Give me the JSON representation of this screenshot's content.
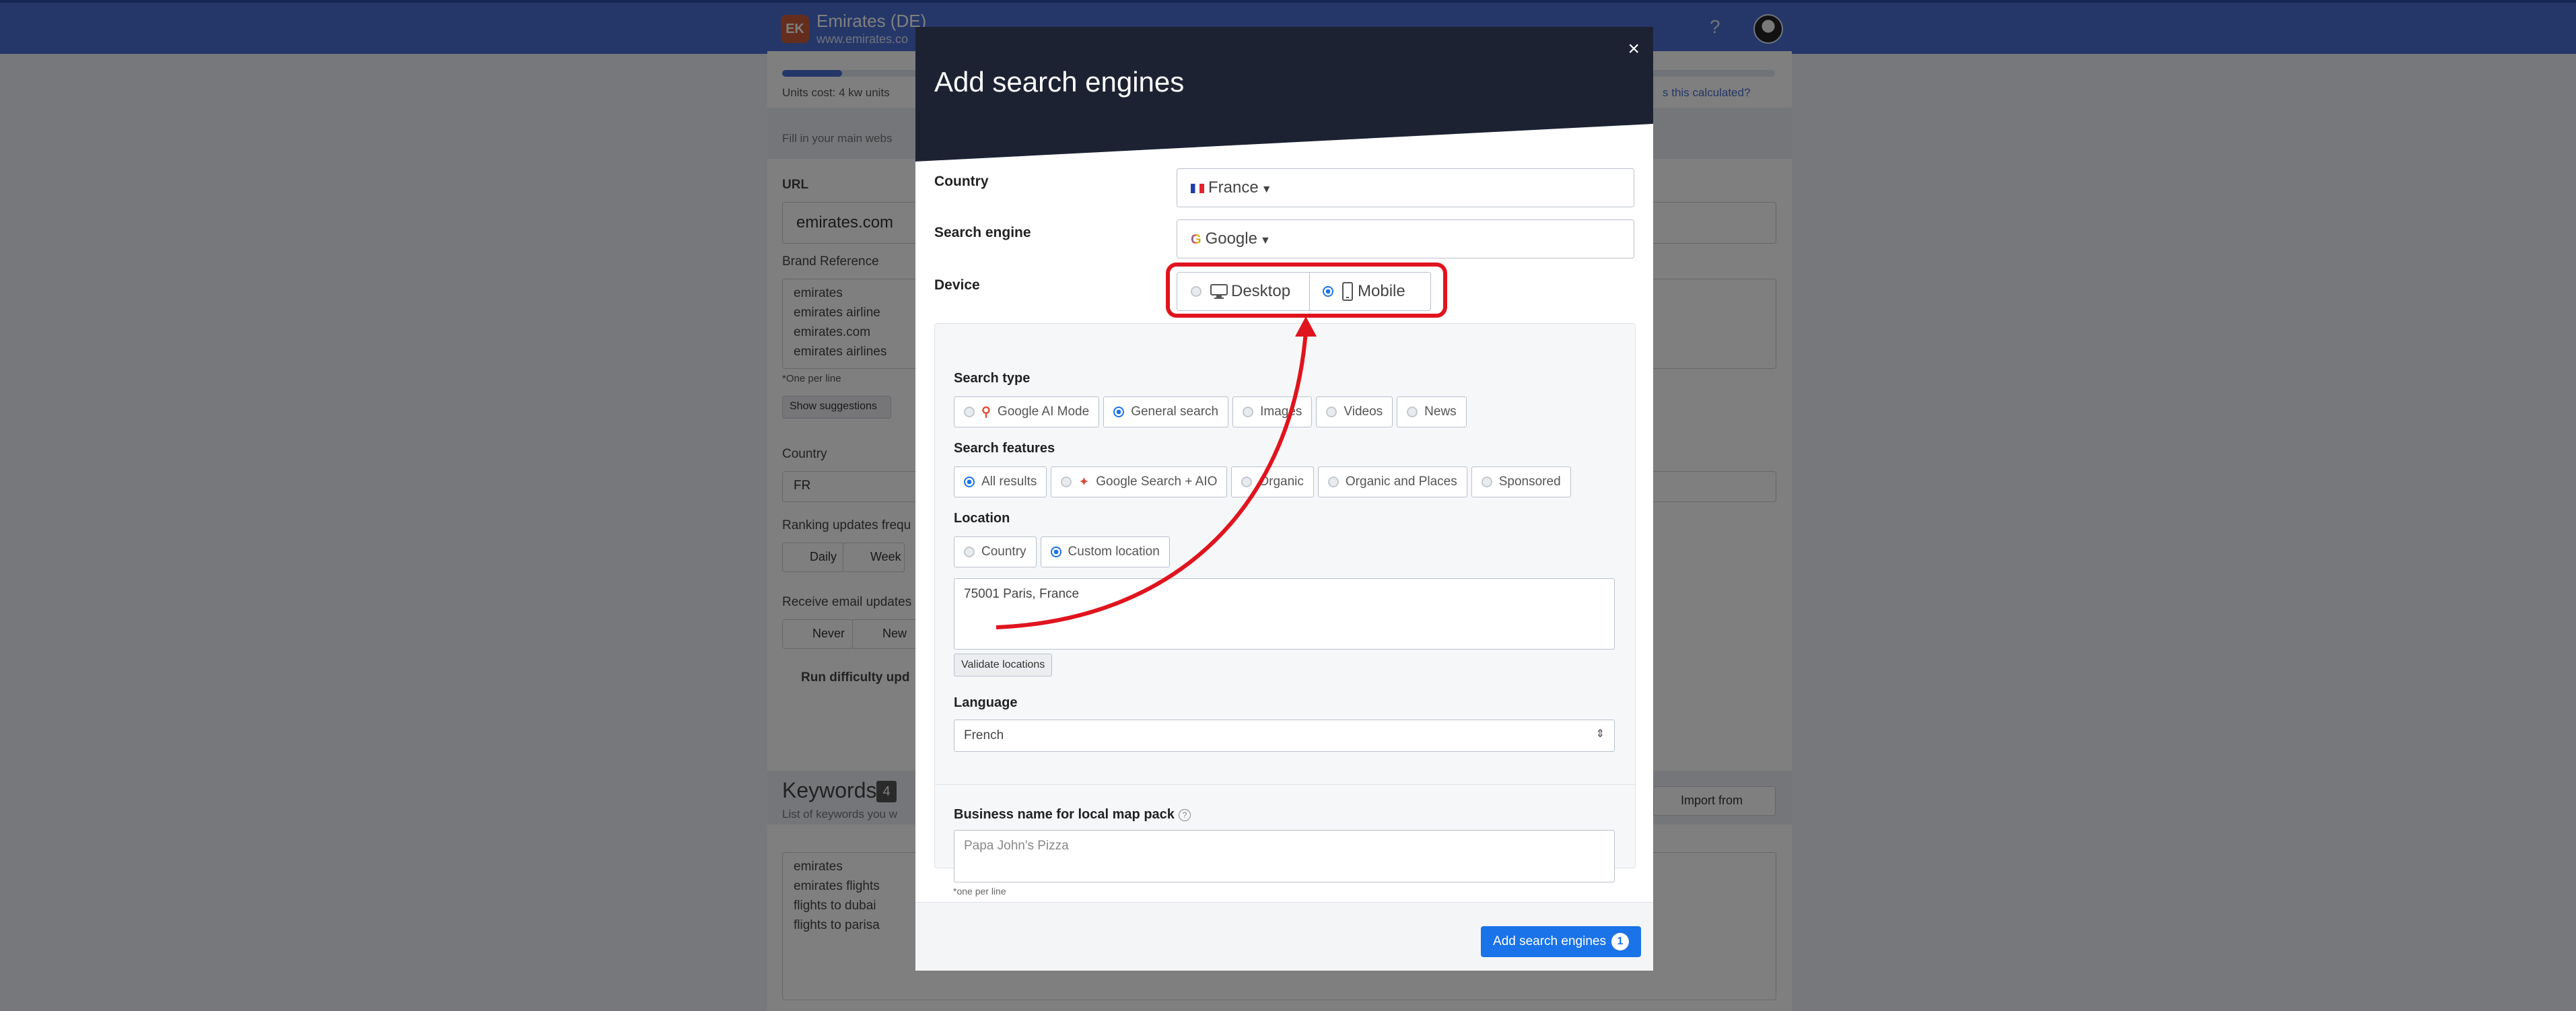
{
  "app": {
    "logo": "EK",
    "title": "Emirates (DE)",
    "url": "www.emirates.co",
    "help_icon": "?",
    "user_menu": "avatar"
  },
  "background": {
    "units_cost": "Units cost: 4 kw units",
    "calc_link": "s this calculated?",
    "fill_in": "Fill in your main webs",
    "url_label": "URL",
    "url_value": "emirates.com",
    "brand_label": "Brand Reference",
    "brand_lines": [
      "emirates",
      "emirates airline",
      "emirates.com",
      "emirates airlines"
    ],
    "one_per_line": "*One per line",
    "show_suggestions": "Show suggestions",
    "country_label": "Country",
    "country_value": "FR",
    "ranking_label": "Ranking updates frequ",
    "ranking_daily": "Daily",
    "ranking_weekly": "Week",
    "email_label": "Receive email updates",
    "email_never": "Never",
    "email_new": "New",
    "difficulty_label": "Run difficulty upd",
    "keywords_title": "Keywords",
    "keywords_count": "4",
    "keywords_desc": "List of keywords you w",
    "import_from": "Import from",
    "keyword_lines": [
      "emirates",
      "emirates flights",
      "flights to dubai",
      "flights to parisa"
    ]
  },
  "modal": {
    "title": "Add search engines",
    "close": "×",
    "country_label": "Country",
    "country_value": "France",
    "engine_label": "Search engine",
    "engine_value": "Google",
    "device_label": "Device",
    "device_desktop": "Desktop",
    "device_mobile": "Mobile",
    "search_type_label": "Search type",
    "search_types": [
      "Google AI Mode",
      "General search",
      "Images",
      "Videos",
      "News"
    ],
    "search_features_label": "Search features",
    "search_features": [
      "All results",
      "Google Search + AIO",
      "Organic",
      "Organic and Places",
      "Sponsored"
    ],
    "location_label": "Location",
    "location_options": [
      "Country",
      "Custom location"
    ],
    "location_value": "75001 Paris, France",
    "validate_button": "Validate locations",
    "language_label": "Language",
    "language_value": "French",
    "business_label": "Business name for local map pack",
    "business_placeholder": "Papa John's Pizza",
    "business_note": "*one per line",
    "submit_label": "Add search engines",
    "submit_count": "1"
  },
  "colors": {
    "topbar": "#4a6fd1",
    "modal_header": "#1d2233",
    "primary": "#1a73e8",
    "annotation": "#e0141e"
  }
}
